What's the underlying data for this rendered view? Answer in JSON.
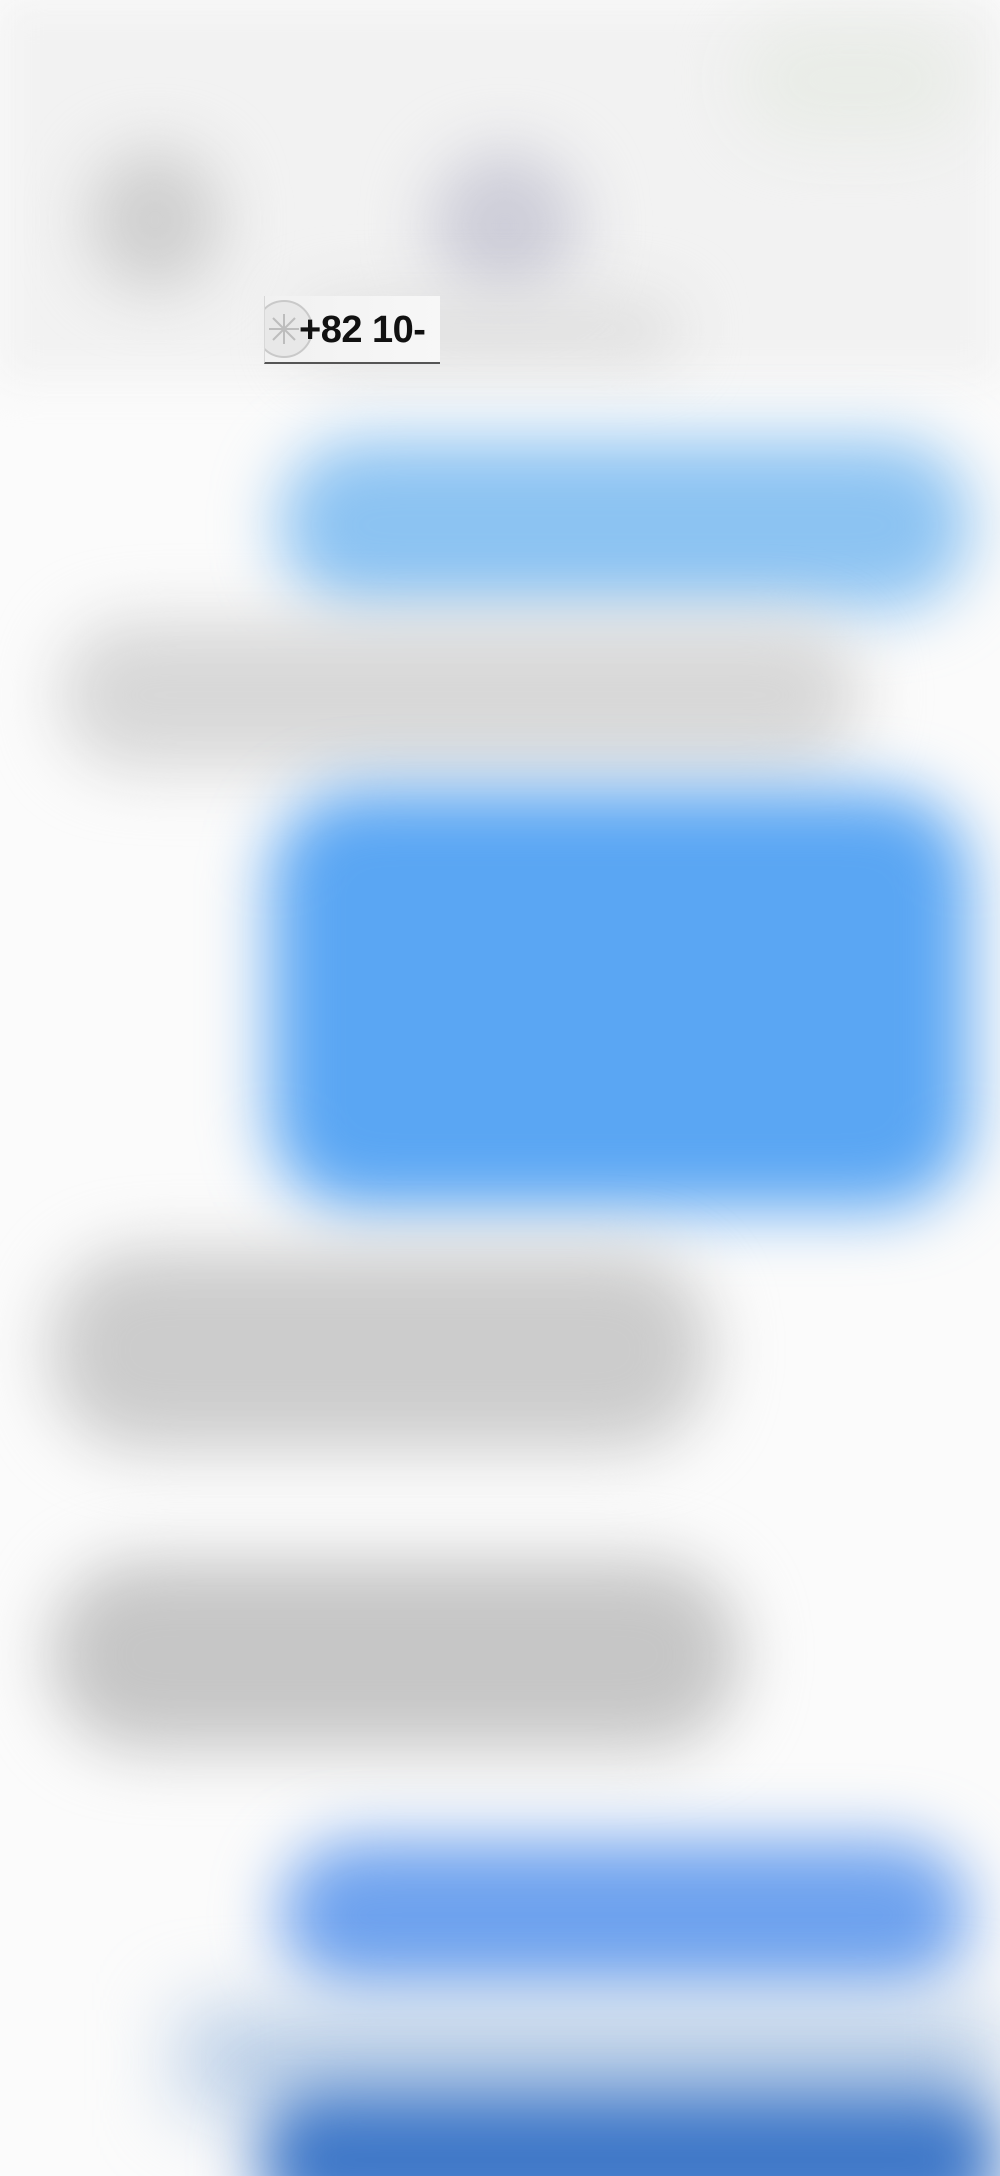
{
  "header": {
    "contact_number": "+82 10-"
  },
  "colors": {
    "outgoing_bubble": "#5aa6f3",
    "incoming_bubble": "#cccccc",
    "background": "#fbfbfb"
  },
  "icons": {
    "contact": "contact-avatar-icon"
  }
}
